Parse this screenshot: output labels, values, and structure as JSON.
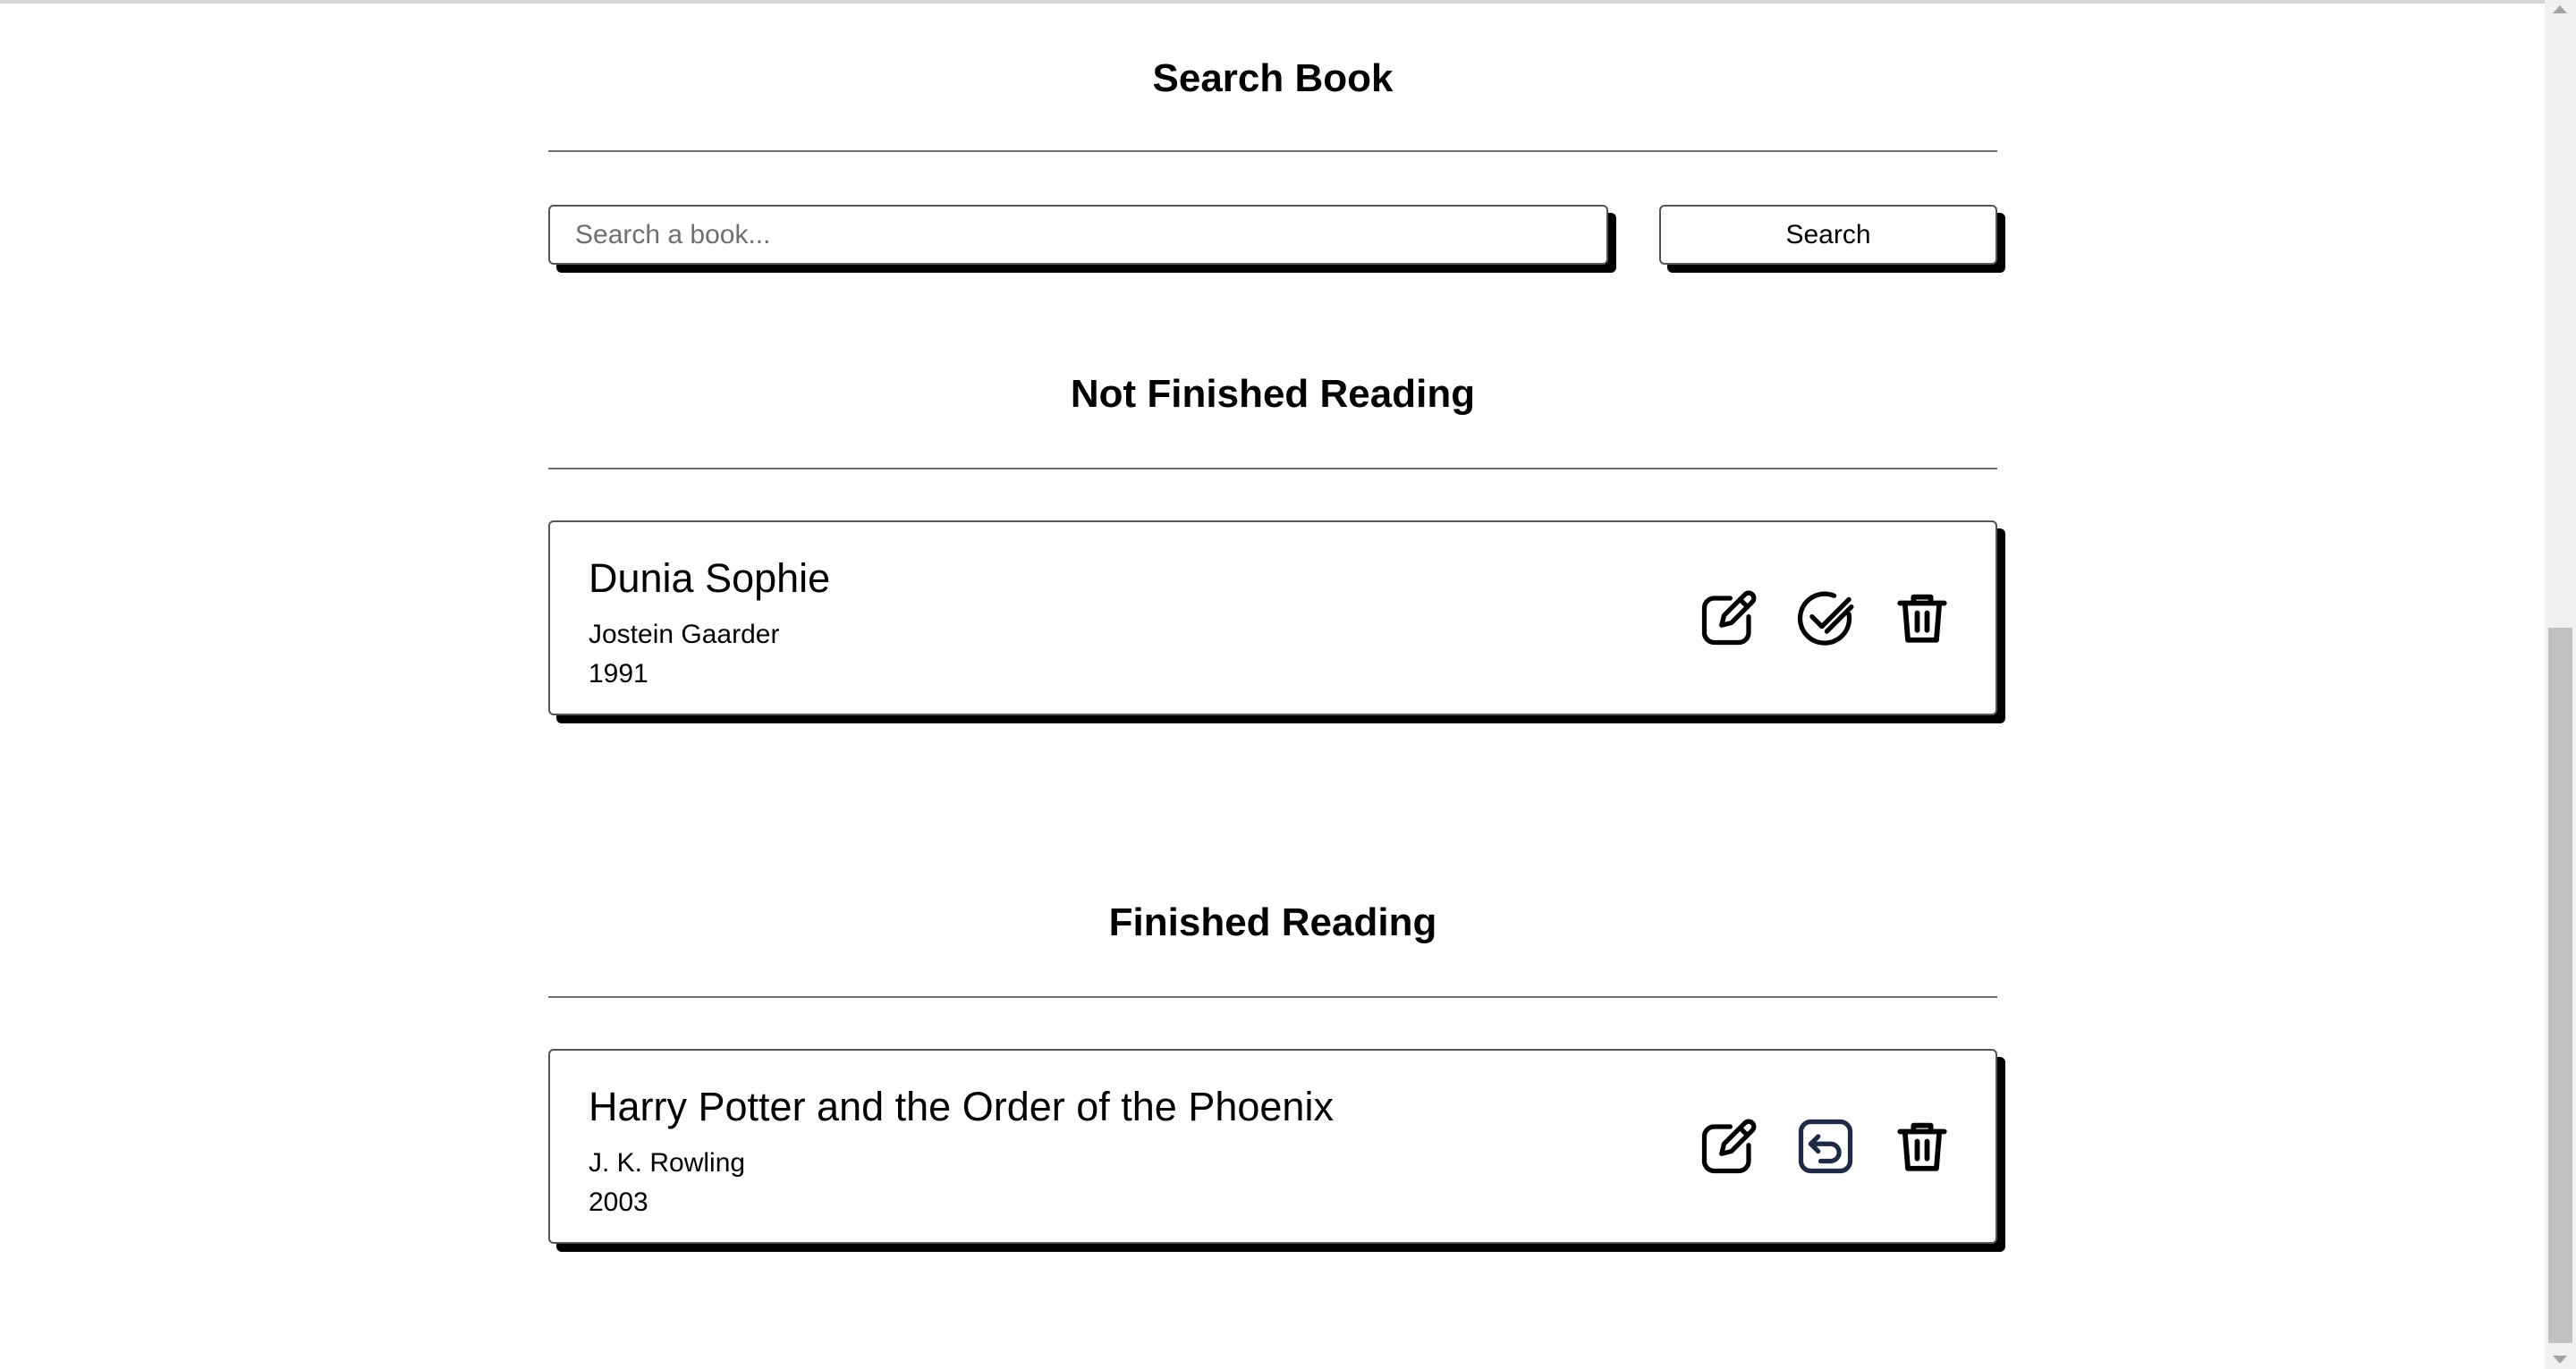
{
  "search": {
    "title": "Search Book",
    "placeholder": "Search a book...",
    "value": "",
    "button_label": "Search"
  },
  "not_finished": {
    "title": "Not Finished Reading",
    "books": [
      {
        "title": "Dunia Sophie",
        "author": "Jostein Gaarder",
        "year": "1991",
        "actions": [
          "edit-icon",
          "check-icon",
          "trash-icon"
        ]
      }
    ]
  },
  "finished": {
    "title": "Finished Reading",
    "books": [
      {
        "title": "Harry Potter and the Order of the Phoenix",
        "author": "J. K. Rowling",
        "year": "2003",
        "actions": [
          "edit-icon",
          "undo-icon",
          "trash-icon"
        ]
      }
    ]
  },
  "colors": {
    "shadow": "#000000",
    "border": "#555555",
    "undo_icon": "#1f2a44"
  }
}
